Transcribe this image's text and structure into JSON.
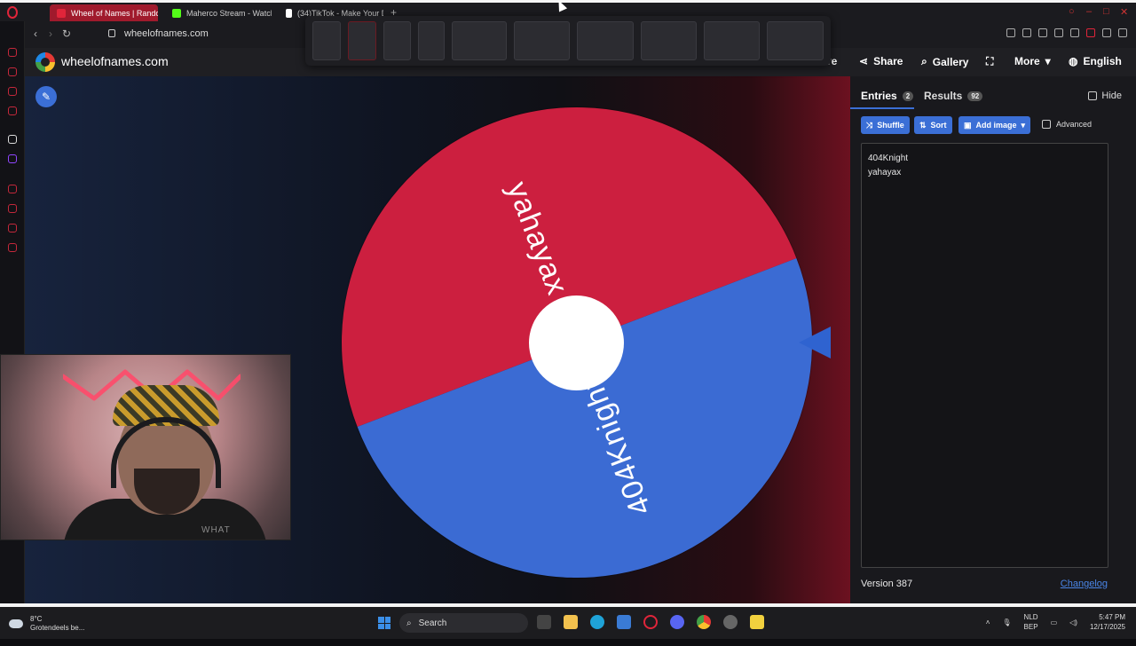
{
  "browser": {
    "tabs": [
      {
        "title": "Wheel of Names | Random",
        "active": true,
        "favicon_color": "#e0253a"
      },
      {
        "title": "Maherco Stream - Watch",
        "active": false,
        "favicon_color": "#53fc18"
      },
      {
        "title": "(34)TikTok - Make Your D",
        "active": false,
        "favicon_color": "#ffffff"
      }
    ],
    "new_tab_icon": "plus-icon",
    "url": "wheelofnames.com"
  },
  "site": {
    "brand": "wheelofnames.com",
    "header_items": [
      {
        "label": "ve",
        "icon": ""
      },
      {
        "label": "Share",
        "icon": "share-icon"
      },
      {
        "label": "Gallery",
        "icon": "search-icon"
      },
      {
        "label": "",
        "icon": "fullscreen-icon"
      },
      {
        "label": "More",
        "icon": "chevron-down-icon"
      },
      {
        "label": "English",
        "icon": "globe-icon"
      }
    ],
    "accent_color": "#3b6fd6"
  },
  "wheel": {
    "segments": [
      {
        "label": "yahayax",
        "color": "#cc1f3f"
      },
      {
        "label": "404Knight",
        "color": "#3b6bd3"
      }
    ],
    "pointer_color": "#2f63d0"
  },
  "panel": {
    "tabs": [
      {
        "label": "Entries",
        "count": "2",
        "active": true
      },
      {
        "label": "Results",
        "count": "92",
        "active": false
      }
    ],
    "hide_label": "Hide",
    "buttons": {
      "shuffle": "Shuffle",
      "sort": "Sort",
      "add_image": "Add image"
    },
    "advanced_label": "Advanced",
    "entries": [
      "404Knight",
      "yahayax"
    ],
    "version": "Version 387",
    "changelog": "Changelog"
  },
  "webcam": {
    "shirt_text": "WHAT"
  },
  "taskbar": {
    "weather_temp": "8°C",
    "weather_desc": "Grotendeels be...",
    "search_placeholder": "Search",
    "lang_top": "NLD",
    "lang_bottom": "BEP",
    "time": "5:47 PM",
    "date": "12/17/2025"
  }
}
